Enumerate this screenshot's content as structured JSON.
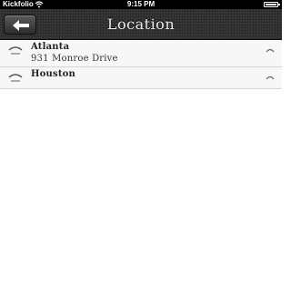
{
  "status_bar": {
    "carrier": "Kickfolio",
    "time": "9:15 PM"
  },
  "nav": {
    "title": "Location",
    "back_icon": "left-arrow-icon"
  },
  "locations": [
    {
      "name": "Atlanta",
      "address": "931 Monroe Drive"
    },
    {
      "name": "Houston",
      "address": ""
    }
  ],
  "colors": {
    "nav_background": "#2b2b2b",
    "list_background": "#f7f7f7",
    "divider": "#d6d6d6"
  }
}
